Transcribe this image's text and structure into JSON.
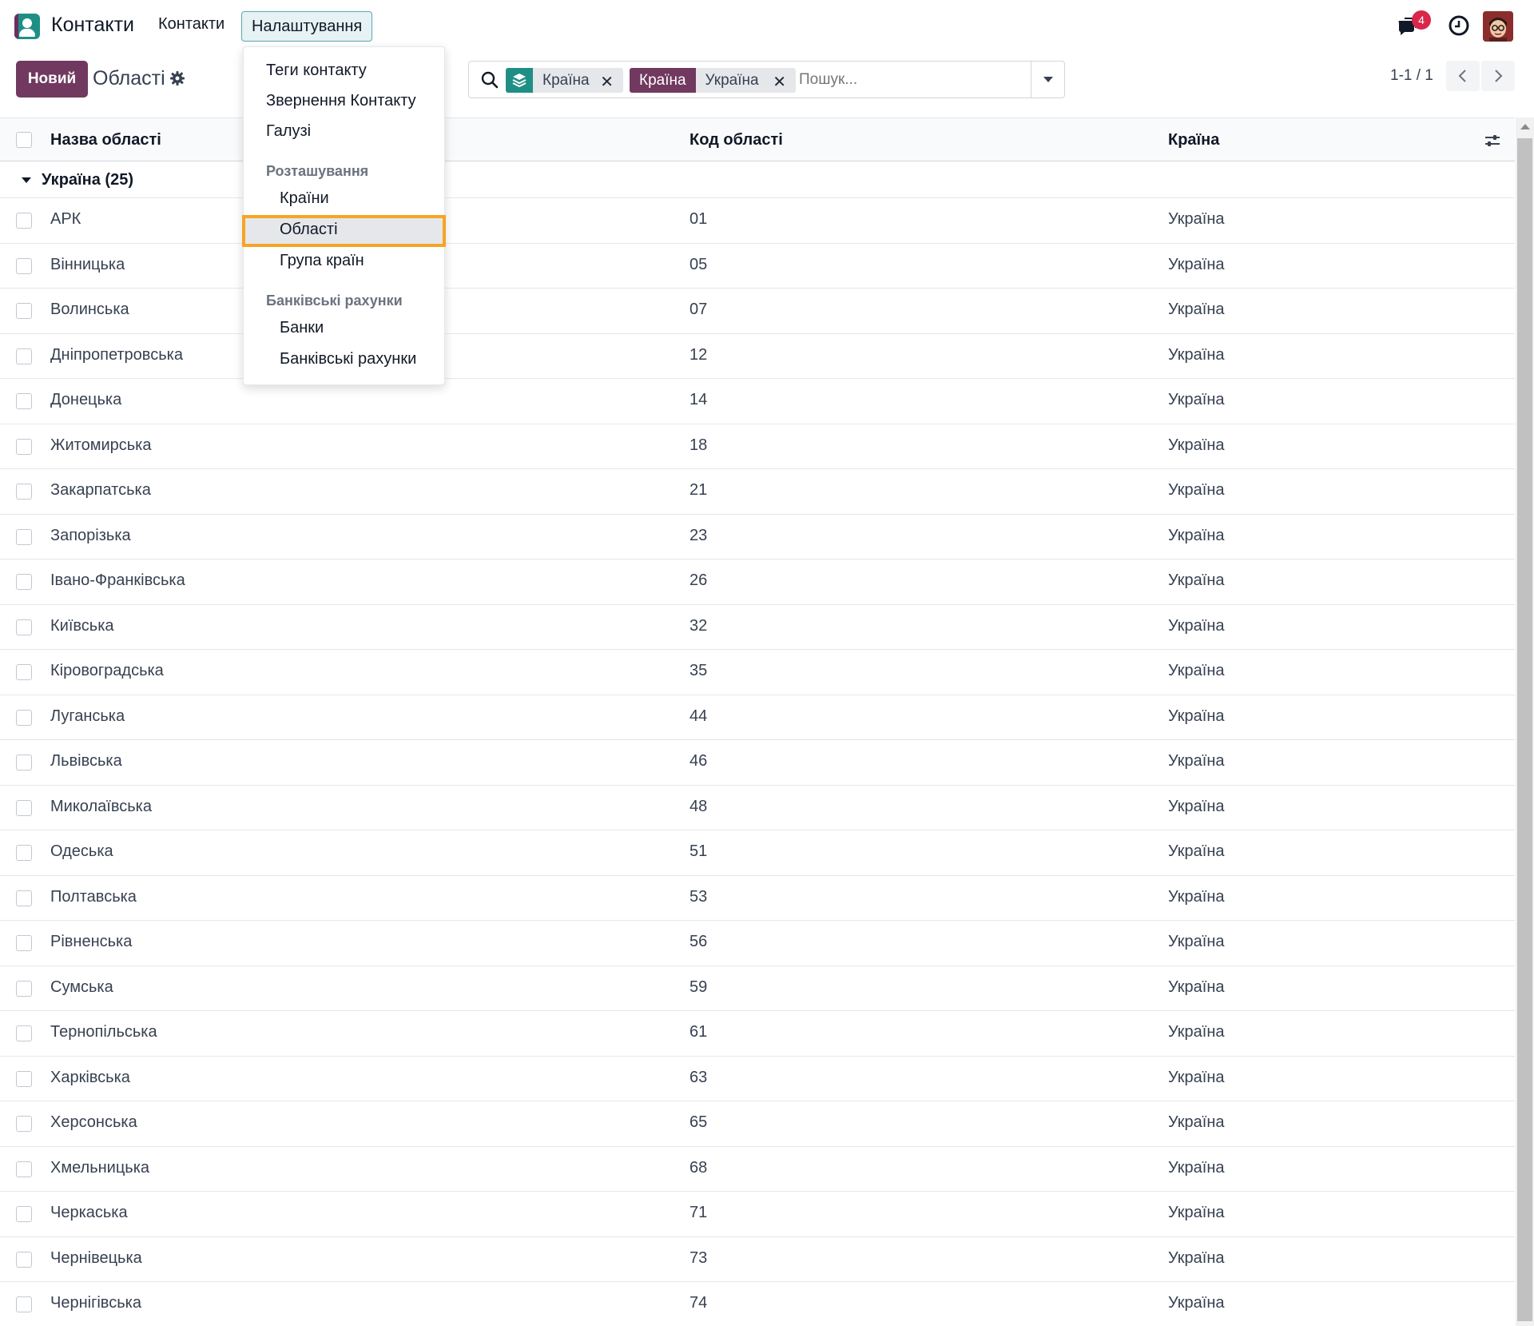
{
  "navbar": {
    "app_name": "Контакти",
    "menu": {
      "contacts": "Контакти",
      "settings": "Налаштування"
    },
    "notifications_count": "4"
  },
  "control_panel": {
    "new_button": "Новий",
    "title": "Області",
    "search": {
      "facets": [
        {
          "icon": "layers-icon",
          "label": "Країна"
        },
        {
          "field": "Країна",
          "value": "Україна"
        }
      ],
      "placeholder": "Пошук..."
    },
    "pager": "1-1 / 1"
  },
  "dropdown": {
    "items": [
      "Теги контакту",
      "Звернення Контакту",
      "Галузі"
    ],
    "section_location": "Розташування",
    "location_items": [
      "Країни",
      "Області",
      "Група країн"
    ],
    "section_bank": "Банківські рахунки",
    "bank_items": [
      "Банки",
      "Банківські рахунки"
    ],
    "selected": "Області"
  },
  "table": {
    "headers": {
      "name": "Назва області",
      "code": "Код області",
      "country": "Країна"
    },
    "group_label": "Україна (25)",
    "rows": [
      {
        "name": "АРК",
        "code": "01",
        "country": "Україна"
      },
      {
        "name": "Вінницька",
        "code": "05",
        "country": "Україна"
      },
      {
        "name": "Волинська",
        "code": "07",
        "country": "Україна"
      },
      {
        "name": "Дніпропетровська",
        "code": "12",
        "country": "Україна"
      },
      {
        "name": "Донецька",
        "code": "14",
        "country": "Україна"
      },
      {
        "name": "Житомирська",
        "code": "18",
        "country": "Україна"
      },
      {
        "name": "Закарпатська",
        "code": "21",
        "country": "Україна"
      },
      {
        "name": "Запорізька",
        "code": "23",
        "country": "Україна"
      },
      {
        "name": "Івано-Франківська",
        "code": "26",
        "country": "Україна"
      },
      {
        "name": "Київська",
        "code": "32",
        "country": "Україна"
      },
      {
        "name": "Кіровоградська",
        "code": "35",
        "country": "Україна"
      },
      {
        "name": "Луганська",
        "code": "44",
        "country": "Україна"
      },
      {
        "name": "Львівська",
        "code": "46",
        "country": "Україна"
      },
      {
        "name": "Миколаївська",
        "code": "48",
        "country": "Україна"
      },
      {
        "name": "Одеська",
        "code": "51",
        "country": "Україна"
      },
      {
        "name": "Полтавська",
        "code": "53",
        "country": "Україна"
      },
      {
        "name": "Рівненська",
        "code": "56",
        "country": "Україна"
      },
      {
        "name": "Сумська",
        "code": "59",
        "country": "Україна"
      },
      {
        "name": "Тернопільська",
        "code": "61",
        "country": "Україна"
      },
      {
        "name": "Харківська",
        "code": "63",
        "country": "Україна"
      },
      {
        "name": "Херсонська",
        "code": "65",
        "country": "Україна"
      },
      {
        "name": "Хмельницька",
        "code": "68",
        "country": "Україна"
      },
      {
        "name": "Черкаська",
        "code": "71",
        "country": "Україна"
      },
      {
        "name": "Чернівецька",
        "code": "73",
        "country": "Україна"
      },
      {
        "name": "Чернігівська",
        "code": "74",
        "country": "Україна"
      }
    ]
  },
  "colors": {
    "brand": "#71395f",
    "accent": "#1f8f86",
    "highlight": "#f5a524",
    "badge": "#d9264b"
  }
}
